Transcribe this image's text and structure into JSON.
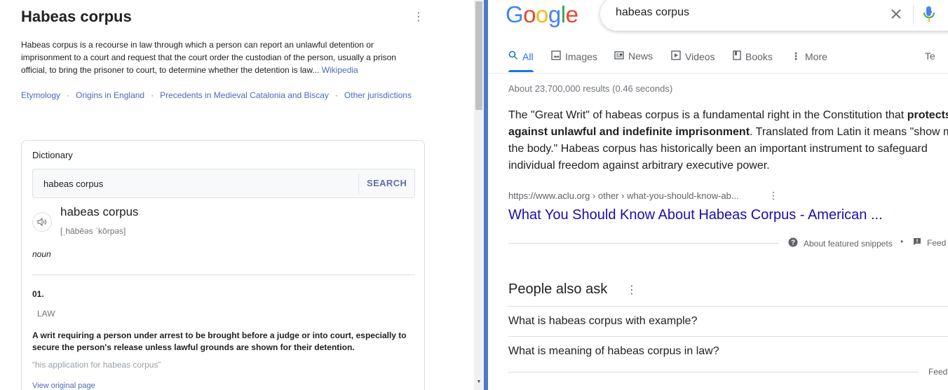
{
  "left": {
    "title": "Habeas corpus",
    "description": "Habeas corpus is a recourse in law through which a person can report an unlawful detention or imprisonment to a court and request that the court order the custodian of the person, usually a prison official, to bring the prisoner to court, to determine whether the detention is law... ",
    "wiki_link": "Wikipedia",
    "sections": [
      "Etymology",
      "Origins in England",
      "Precedents in Medieval Catalonia and Biscay",
      "Other jurisdictions"
    ],
    "dictionary": {
      "title": "Dictionary",
      "search_value": "habeas corpus",
      "search_button": "SEARCH",
      "word": "habeas corpus",
      "phonetic": "[ˌhābēəs ˈkôrpəs]",
      "part_of_speech": "noun",
      "sense_number": "01.",
      "sense_label": "LAW",
      "definition": "A writ requiring a person under arrest to be brought before a judge or into court, especially to secure the person's release unless lawful grounds are shown for their detention.",
      "example": "“his application for habeas corpus”",
      "view_original": "View original page"
    }
  },
  "right": {
    "logo_letters": [
      "G",
      "o",
      "o",
      "g",
      "l",
      "e"
    ],
    "logo_colors": [
      "#4285f4",
      "#ea4335",
      "#fbbc05",
      "#4285f4",
      "#34a853",
      "#ea4335"
    ],
    "search_value": "habeas corpus",
    "tabs": [
      {
        "label": "All",
        "icon": "search-icon"
      },
      {
        "label": "Images",
        "icon": "image-icon"
      },
      {
        "label": "News",
        "icon": "news-icon"
      },
      {
        "label": "Videos",
        "icon": "video-icon"
      },
      {
        "label": "Books",
        "icon": "book-icon"
      },
      {
        "label": "More",
        "icon": "kebab-icon"
      },
      {
        "label": "Te",
        "icon": ""
      }
    ],
    "stats": "About 23,700,000 results (0.46 seconds)",
    "snippet": {
      "line1_plain": "The \"Great Writ\" of habeas corpus is a fundamental right in the Constitution that ",
      "line1_bold": "protects",
      "line2_bold": "against unlawful and indefinite imprisonment",
      "line2_plain": ". Translated from Latin it means \"show m",
      "line3": "the body.\" Habeas corpus has historically been an important instrument to safeguard",
      "line4": "individual freedom against arbitrary executive power."
    },
    "cite": "https://www.aclu.org › other › what-you-should-know-ab...",
    "result_title": "What You Should Know About Habeas Corpus - American ...",
    "about_snippets": "About featured snippets",
    "feedback_dot": "•",
    "feedback": "Feed",
    "paa_title": "People also ask",
    "paa_questions": [
      "What is habeas corpus with example?",
      "What is meaning of habeas corpus in law?"
    ],
    "paa_feedback": "Feed"
  },
  "colors": {
    "link": "#1a0dab",
    "accent_blue": "#1a73e8",
    "divider_blue": "#4b79cc"
  }
}
